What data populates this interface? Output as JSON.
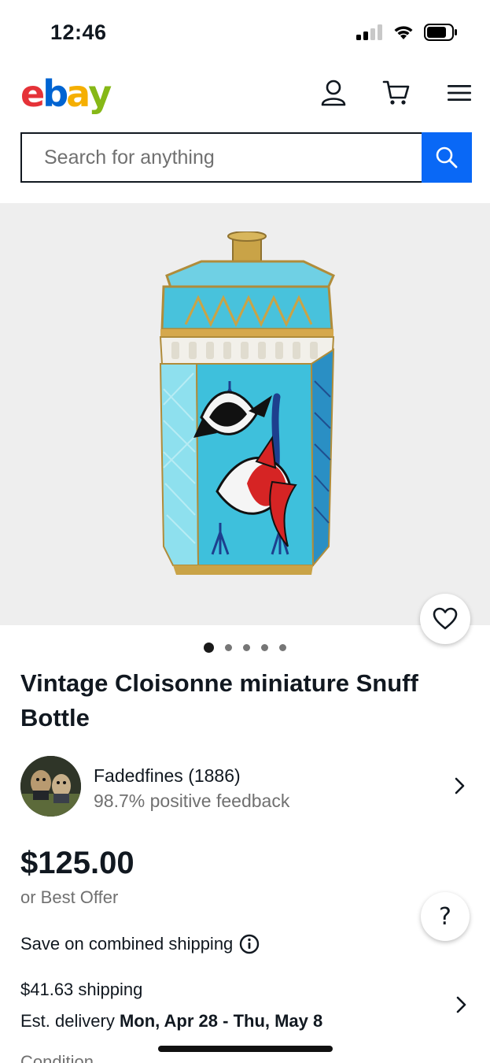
{
  "status_bar": {
    "time": "12:46"
  },
  "header": {
    "logo_letters": [
      "e",
      "b",
      "a",
      "y"
    ],
    "logo_colors": [
      "#e53238",
      "#0064d2",
      "#f5af02",
      "#86b817"
    ]
  },
  "search": {
    "placeholder": "Search for anything"
  },
  "gallery": {
    "image_count": 5,
    "active_index": 0
  },
  "listing": {
    "title": "Vintage Cloisonne miniature Snuff Bottle",
    "seller_name": "Fadedfines (1886)",
    "seller_feedback": "98.7% positive feedback",
    "price": "$125.00",
    "best_offer": "or Best Offer",
    "combined_shipping": "Save on combined shipping",
    "shipping_cost": "$41.63 shipping",
    "delivery_prefix": "Est. delivery ",
    "delivery_dates": "Mon, Apr 28 - Thu, May 8",
    "condition_partial": "Condition"
  },
  "colors": {
    "accent": "#0968f6",
    "text": "#111820",
    "muted": "#707070"
  }
}
